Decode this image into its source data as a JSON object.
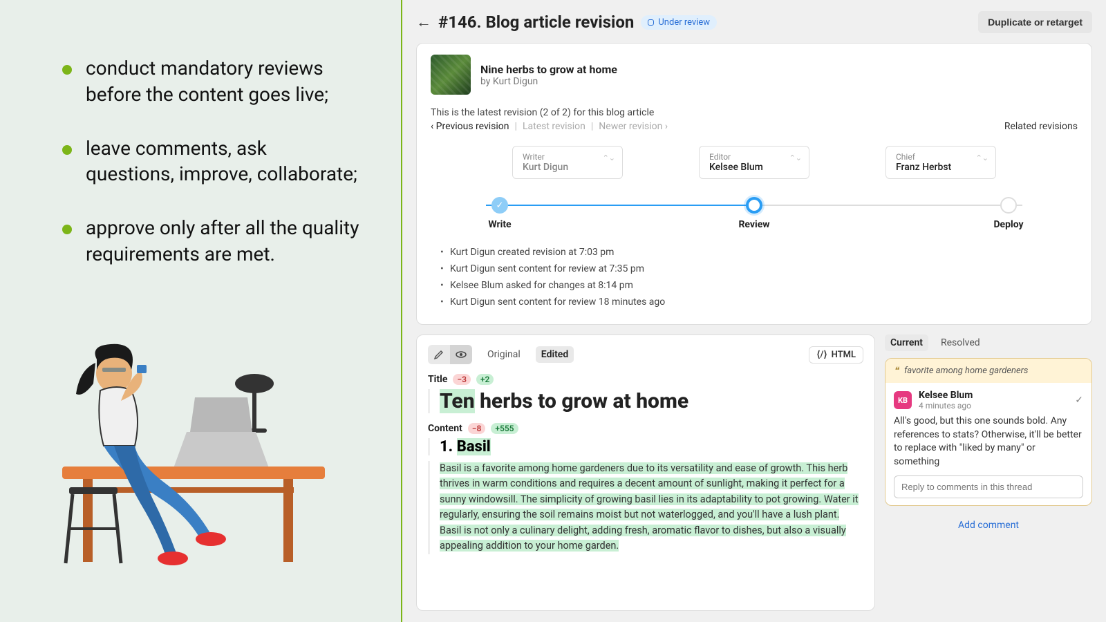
{
  "left": {
    "bullets": [
      "conduct mandatory reviews before the content goes live;",
      "leave comments, ask questions, improve, collaborate;",
      "approve only after all the quality requirements are met."
    ]
  },
  "header": {
    "title": "#146. Blog article revision",
    "status": "Under review",
    "duplicate_label": "Duplicate or retarget"
  },
  "article": {
    "title": "Nine herbs to grow at home",
    "author_prefix": "by ",
    "author": "Kurt Digun"
  },
  "revision": {
    "info": "This is the latest revision (2 of 2) for this blog article",
    "prev": "‹ Previous revision",
    "latest": "Latest revision",
    "newer": "Newer revision ›",
    "related": "Related revisions"
  },
  "roles": {
    "writer_label": "Writer",
    "writer_name": "Kurt Digun",
    "editor_label": "Editor",
    "editor_name": "Kelsee Blum",
    "chief_label": "Chief",
    "chief_name": "Franz Herbst"
  },
  "steps": {
    "write": "Write",
    "review": "Review",
    "deploy": "Deploy"
  },
  "activity": [
    "Kurt Digun created revision at 7:03 pm",
    "Kurt Digun sent content for review at 7:35 pm",
    "Kelsee Blum asked for changes at 8:14 pm",
    "Kurt Digun sent content for review 18 minutes ago"
  ],
  "content": {
    "tab_original": "Original",
    "tab_edited": "Edited",
    "html_btn": "HTML",
    "title_label": "Title",
    "title_del": "−3",
    "title_add": "+2",
    "title_added_word": "Ten",
    "title_rest": " herbs to grow at home",
    "content_label": "Content",
    "content_del": "−8",
    "content_add": "+555",
    "heading_num": "1. ",
    "heading_word": "Basil",
    "body": "Basil is a favorite among home gardeners due to its versatility and ease of growth. This herb thrives in warm conditions and requires a decent amount of sunlight, making it perfect for a sunny windowsill. The simplicity of growing basil lies in its adaptability to pot growing. Water it regularly, ensuring the soil remains moist but not waterlogged, and you'll have a lush plant. Basil is not only a culinary delight, adding fresh, aromatic flavor to dishes, but also a visually appealing addition to your home garden."
  },
  "comments": {
    "tab_current": "Current",
    "tab_resolved": "Resolved",
    "quote": "favorite among home gardeners",
    "author_initials": "KB",
    "author": "Kelsee Blum",
    "time": "4 minutes ago",
    "text": "All's good, but this one sounds bold. Any references to stats? Otherwise, it'll be better to replace with \"liked by many\" or something",
    "reply_placeholder": "Reply to comments in this thread",
    "add_label": "Add comment"
  }
}
